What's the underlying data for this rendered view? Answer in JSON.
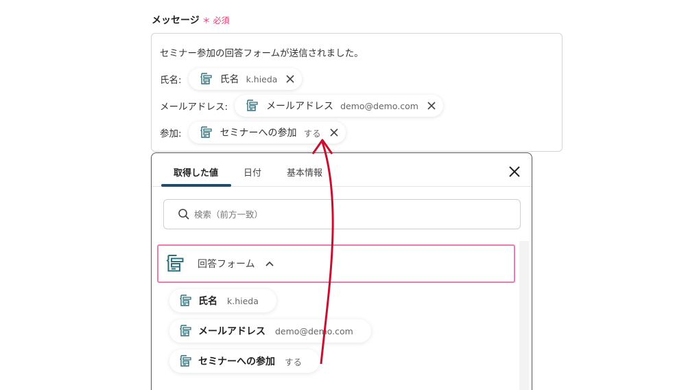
{
  "field": {
    "label": "メッセージ",
    "required_mark": "＊",
    "required_text": "必須"
  },
  "editor": {
    "line1": "セミナー参加の回答フォームが送信されました。",
    "rows": [
      {
        "label": "氏名:",
        "chip_name": "氏名",
        "chip_value": "k.hieda"
      },
      {
        "label": "メールアドレス:",
        "chip_name": "メールアドレス",
        "chip_value": "demo@demo.com"
      },
      {
        "label": "参加:",
        "chip_name": "セミナーへの参加",
        "chip_value": "する"
      }
    ]
  },
  "panel": {
    "tabs": [
      "取得した値",
      "日付",
      "基本情報"
    ],
    "active_tab": "取得した値",
    "search_placeholder": "検索（前方一致）",
    "group": {
      "name": "回答フォーム",
      "expanded": true
    },
    "items": [
      {
        "name": "氏名",
        "value": "k.hieda"
      },
      {
        "name": "メールアドレス",
        "value": "demo@demo.com"
      },
      {
        "name": "セミナーへの参加",
        "value": "する"
      }
    ]
  },
  "colors": {
    "required": "#e23d6e",
    "tab_underline": "#1e4d6b",
    "group_border": "#e97bb0",
    "icon_teal": "#2a6f7a",
    "arrow": "#c8102e"
  },
  "icons": {
    "form": "form-document-icon",
    "remove": "close-icon",
    "search": "search-icon",
    "collapse": "chevron-up-icon"
  }
}
